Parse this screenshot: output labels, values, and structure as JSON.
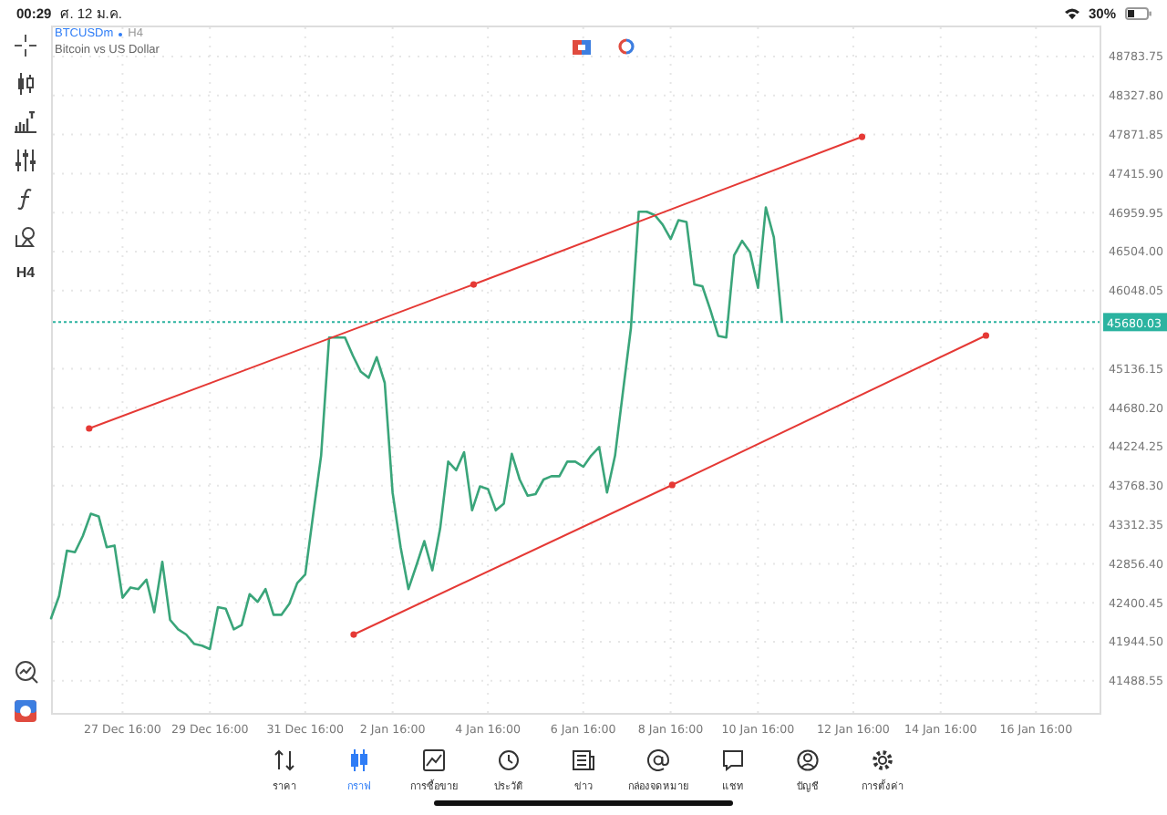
{
  "status_bar": {
    "time": "00:29",
    "date": "ศ. 12 ม.ค.",
    "battery": "30%"
  },
  "toolbar": {
    "timeframe": "H4"
  },
  "chart": {
    "symbol": "BTCUSDm",
    "timeframe": "H4",
    "description": "Bitcoin vs US Dollar",
    "current_price": "45680.03",
    "chart_data": {
      "type": "line",
      "grid": true,
      "categories": [
        null,
        null,
        null,
        null,
        null,
        null,
        null,
        null,
        null,
        "27 Dec 16:00",
        null,
        null,
        null,
        null,
        null,
        null,
        null,
        null,
        null,
        null,
        "29 Dec 16:00",
        null,
        null,
        null,
        null,
        null,
        null,
        null,
        null,
        null,
        null,
        null,
        "31 Dec 16:00",
        null,
        null,
        null,
        null,
        null,
        null,
        null,
        null,
        null,
        null,
        "2 Jan 16:00",
        null,
        null,
        null,
        null,
        null,
        null,
        null,
        null,
        null,
        null,
        null,
        "4 Jan 16:00",
        null,
        null,
        null,
        null,
        null,
        null,
        null,
        null,
        null,
        null,
        null,
        "6 Jan 16:00",
        null,
        null,
        null,
        null,
        null,
        null,
        null,
        null,
        null,
        null,
        "8 Jan 16:00",
        null,
        null,
        null,
        null,
        null,
        null,
        null,
        null,
        null,
        null,
        "10 Jan 16:00",
        null,
        null,
        null,
        null,
        null,
        null,
        null,
        null,
        null,
        null,
        null,
        "12 Jan 16:00",
        null,
        null,
        null,
        null,
        null,
        null,
        null,
        null,
        null,
        null,
        "14 Jan 16:00",
        null,
        null,
        null,
        null,
        null,
        null,
        null,
        null,
        null,
        null,
        null,
        "16 Jan 16:00",
        null,
        null,
        null,
        null,
        null,
        null,
        null,
        null
      ],
      "series": [
        {
          "color": "#3aa57a",
          "values": [
            42220,
            42480,
            43010,
            42990,
            43180,
            43440,
            43410,
            43050,
            43070,
            42460,
            42580,
            42560,
            42670,
            42290,
            42880,
            42200,
            42090,
            42030,
            41920,
            41900,
            41860,
            42350,
            42330,
            42090,
            42140,
            42500,
            42410,
            42560,
            42260,
            42260,
            42390,
            42630,
            42730,
            43440,
            44120,
            45500,
            45500,
            45500,
            45290,
            45100,
            45030,
            45270,
            44970,
            43690,
            43050,
            42560,
            42840,
            43120,
            42780,
            43270,
            44050,
            43950,
            44160,
            43480,
            43760,
            43730,
            43480,
            43560,
            44140,
            43840,
            43650,
            43670,
            43840,
            43880,
            43880,
            44050,
            44050,
            43990,
            44120,
            44220,
            43690,
            44120,
            44860,
            45610,
            46970,
            46970,
            46930,
            46820,
            46650,
            46870,
            46850,
            46120,
            46100,
            45820,
            45520,
            45500,
            46460,
            46630,
            46500,
            46080,
            47020,
            46670,
            45690,
            null,
            null,
            null,
            null,
            null,
            null,
            null,
            null,
            null,
            null,
            null,
            null,
            null,
            null,
            null,
            null,
            null,
            null,
            null,
            null,
            null,
            null,
            null,
            null,
            null,
            null,
            null,
            null,
            null,
            null,
            null,
            null,
            null,
            null,
            null,
            null,
            null,
            null,
            null,
            null
          ]
        }
      ],
      "ylim": [
        41092,
        49146
      ],
      "yticks": [
        {
          "value": 48783.75,
          "label": "48783.75"
        },
        {
          "value": 48327.8,
          "label": "48327.80"
        },
        {
          "value": 47871.85,
          "label": "47871.85"
        },
        {
          "value": 47415.9,
          "label": "47415.90"
        },
        {
          "value": 46959.95,
          "label": "46959.95"
        },
        {
          "value": 46504,
          "label": "46504.00"
        },
        {
          "value": 46048.05,
          "label": "46048.05"
        },
        {
          "value": 45136.15,
          "label": "45136.15"
        },
        {
          "value": 44680.2,
          "label": "44680.20"
        },
        {
          "value": 44224.25,
          "label": "44224.25"
        },
        {
          "value": 43768.3,
          "label": "43768.30"
        },
        {
          "value": 43312.35,
          "label": "43312.35"
        },
        {
          "value": 42856.4,
          "label": "42856.40"
        },
        {
          "value": 42400.45,
          "label": "42400.45"
        },
        {
          "value": 41944.5,
          "label": "41944.50"
        },
        {
          "value": 41488.55,
          "label": "41488.55"
        }
      ]
    }
  },
  "nav": [
    {
      "label": "ราคา",
      "selected": false
    },
    {
      "label": "กราฟ",
      "selected": true
    },
    {
      "label": "การซื้อขาย",
      "selected": false
    },
    {
      "label": "ประวัติ",
      "selected": false
    },
    {
      "label": "ข่าว",
      "selected": false
    },
    {
      "label": "กล่องจดหมาย",
      "selected": false
    },
    {
      "label": "แชท",
      "selected": false
    },
    {
      "label": "บัญชี",
      "selected": false
    },
    {
      "label": "การตั้งค่า",
      "selected": false
    }
  ]
}
